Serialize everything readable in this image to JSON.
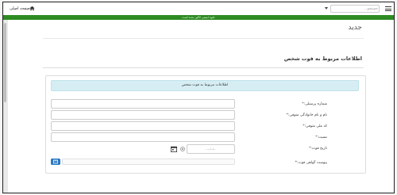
{
  "header": {
    "home_label": "صفحه اصلی",
    "search_placeholder": "جستجو...",
    "notice": "جلوه امنیتی لاگین شده است"
  },
  "page": {
    "title": "جدید",
    "section_title": "اطلاعات مربوط به فوت شخص"
  },
  "form": {
    "panel_title": "اطلاعات مربوط به فوت شخص",
    "fields": [
      {
        "label": "شماره پرسنلی:*"
      },
      {
        "label": "نام و نام خانوادگی متوفی:*"
      },
      {
        "label": "کد ملی متوفی:*"
      },
      {
        "label": "نسبت:*"
      },
      {
        "label": "تاریخ فوت:*",
        "placeholder": "----/--/--"
      },
      {
        "label": "پیوست گواهی فوت:*"
      }
    ]
  },
  "icons": {
    "home": "home-icon",
    "menu": "hamburger-icon",
    "calendar": "calendar-icon",
    "clear": "clear-icon",
    "upload": "upload-icon"
  },
  "colors": {
    "notice_bar": "#2e8b22",
    "panel_header": "#d6eef3",
    "upload_button": "#2b78c2"
  }
}
